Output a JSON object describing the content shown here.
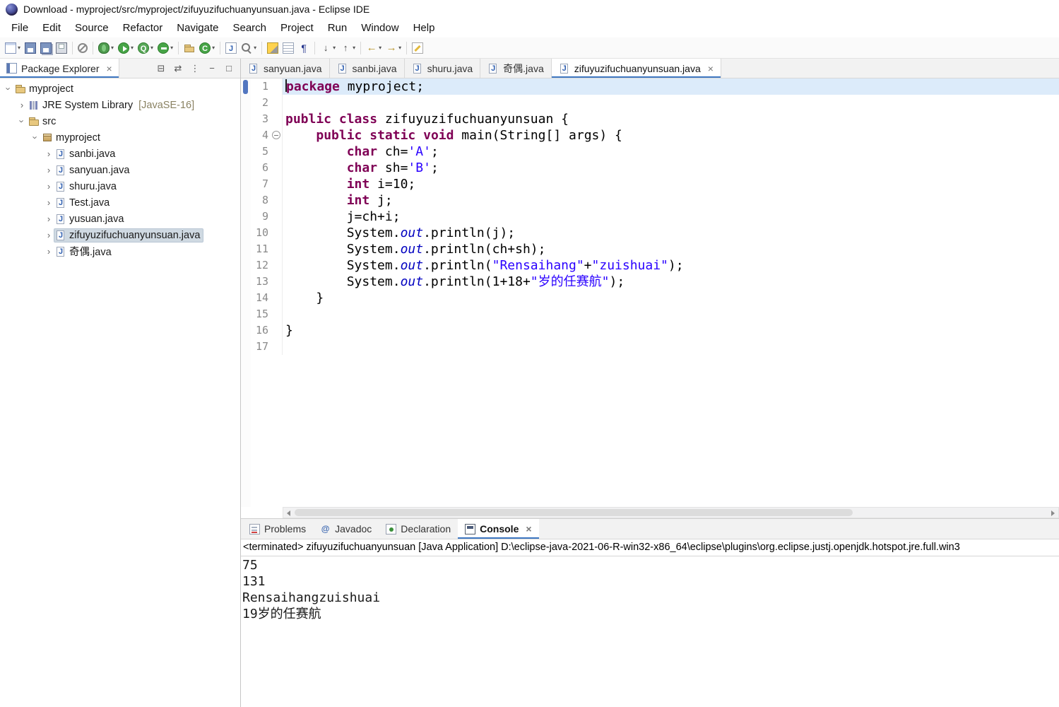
{
  "window": {
    "title": "Download - myproject/src/myproject/zifuyuzifuchuanyunsuan.java - Eclipse IDE"
  },
  "menubar": {
    "items": [
      "File",
      "Edit",
      "Source",
      "Refactor",
      "Navigate",
      "Search",
      "Project",
      "Run",
      "Window",
      "Help"
    ]
  },
  "glyphs": {
    "dropdown": "▾",
    "tree_collapsed": "›",
    "close": "×"
  },
  "toolbar": {
    "items": [
      {
        "name": "new-wizard",
        "icon": "new",
        "dd": true
      },
      {
        "name": "save",
        "icon": "save"
      },
      {
        "name": "save-all",
        "icon": "save-all"
      },
      {
        "name": "print",
        "icon": "print"
      },
      {
        "sep": true
      },
      {
        "name": "skip-all-breakpoints",
        "icon": "skip-bp"
      },
      {
        "sep": true
      },
      {
        "name": "debug",
        "icon": "debug",
        "dd": true
      },
      {
        "name": "run",
        "icon": "run",
        "dd": true
      },
      {
        "name": "coverage",
        "icon": "coverage",
        "dd": true
      },
      {
        "name": "run-external-tools",
        "icon": "external",
        "dd": true
      },
      {
        "sep": true
      },
      {
        "name": "new-java-project",
        "icon": "java-project"
      },
      {
        "name": "new-java-class",
        "icon": "java-class",
        "dd": true
      },
      {
        "sep": true
      },
      {
        "name": "open-type",
        "icon": "open-type"
      },
      {
        "name": "search",
        "icon": "search",
        "dd": true
      },
      {
        "sep": true
      },
      {
        "name": "toggle-mark-occurrences",
        "icon": "mark-occ"
      },
      {
        "name": "show-annotations",
        "icon": "annot"
      },
      {
        "name": "show-whitespace",
        "icon": "pilcrow",
        "glyph": "¶"
      },
      {
        "sep": true
      },
      {
        "name": "next-annotation",
        "icon": "next-annot",
        "glyph": "↓",
        "dd": true
      },
      {
        "name": "previous-annotation",
        "icon": "prev-annot",
        "glyph": "↑",
        "dd": true
      },
      {
        "sep": true
      },
      {
        "name": "back",
        "icon": "back",
        "glyph": "←",
        "dd": true
      },
      {
        "name": "forward",
        "icon": "forward",
        "glyph": "→",
        "dd": true
      },
      {
        "sep": true
      },
      {
        "name": "last-edit-location",
        "icon": "last-edit"
      }
    ]
  },
  "package_explorer": {
    "title": "Package Explorer",
    "actions": [
      {
        "name": "collapse-all",
        "glyph": "⊟"
      },
      {
        "name": "link-with-editor",
        "glyph": "⇄"
      },
      {
        "name": "view-menu",
        "glyph": "⋮"
      },
      {
        "name": "minimize",
        "glyph": "−"
      },
      {
        "name": "maximize",
        "glyph": "□"
      }
    ],
    "tree": [
      {
        "level": 0,
        "expanded": true,
        "icon": "project",
        "label": "myproject"
      },
      {
        "level": 1,
        "expanded": false,
        "icon": "library",
        "label": "JRE System Library",
        "decoration": "[JavaSE-16]"
      },
      {
        "level": 1,
        "expanded": true,
        "icon": "src",
        "label": "src"
      },
      {
        "level": 2,
        "expanded": true,
        "icon": "package",
        "label": "myproject"
      },
      {
        "level": 3,
        "expanded": false,
        "icon": "java",
        "label": "sanbi.java"
      },
      {
        "level": 3,
        "expanded": false,
        "icon": "java",
        "label": "sanyuan.java"
      },
      {
        "level": 3,
        "expanded": false,
        "icon": "java",
        "label": "shuru.java"
      },
      {
        "level": 3,
        "expanded": false,
        "icon": "java",
        "label": "Test.java"
      },
      {
        "level": 3,
        "expanded": false,
        "icon": "java",
        "label": "yusuan.java"
      },
      {
        "level": 3,
        "expanded": false,
        "icon": "java",
        "label": "zifuyuzifuchuanyunsuan.java",
        "selected": true
      },
      {
        "level": 3,
        "expanded": false,
        "icon": "java",
        "label": "奇偶.java"
      }
    ]
  },
  "editor": {
    "tabs": [
      {
        "label": "sanyuan.java"
      },
      {
        "label": "sanbi.java"
      },
      {
        "label": "shuru.java"
      },
      {
        "label": "奇偶.java"
      },
      {
        "label": "zifuyuzifuchuanyunsuan.java",
        "active": true
      }
    ],
    "current_line": 1,
    "lines": [
      {
        "num": 1,
        "seg": [
          {
            "t": "kw",
            "s": "package"
          },
          {
            "t": "p",
            "s": " myproject;"
          }
        ]
      },
      {
        "num": 2,
        "seg": []
      },
      {
        "num": 3,
        "seg": [
          {
            "t": "kw",
            "s": "public"
          },
          {
            "t": "p",
            "s": " "
          },
          {
            "t": "kw",
            "s": "class"
          },
          {
            "t": "p",
            "s": " zifuyuzifuchuanyunsuan {"
          }
        ]
      },
      {
        "num": 4,
        "fold": true,
        "seg": [
          {
            "t": "p",
            "s": "    "
          },
          {
            "t": "kw",
            "s": "public"
          },
          {
            "t": "p",
            "s": " "
          },
          {
            "t": "kw",
            "s": "static"
          },
          {
            "t": "p",
            "s": " "
          },
          {
            "t": "kw",
            "s": "void"
          },
          {
            "t": "p",
            "s": " main(String[] args) {"
          }
        ]
      },
      {
        "num": 5,
        "seg": [
          {
            "t": "p",
            "s": "        "
          },
          {
            "t": "kw",
            "s": "char"
          },
          {
            "t": "p",
            "s": " ch="
          },
          {
            "t": "str",
            "s": "'A'"
          },
          {
            "t": "p",
            "s": ";"
          }
        ]
      },
      {
        "num": 6,
        "seg": [
          {
            "t": "p",
            "s": "        "
          },
          {
            "t": "kw",
            "s": "char"
          },
          {
            "t": "p",
            "s": " sh="
          },
          {
            "t": "str",
            "s": "'B'"
          },
          {
            "t": "p",
            "s": ";"
          }
        ]
      },
      {
        "num": 7,
        "seg": [
          {
            "t": "p",
            "s": "        "
          },
          {
            "t": "kw",
            "s": "int"
          },
          {
            "t": "p",
            "s": " i=10;"
          }
        ]
      },
      {
        "num": 8,
        "seg": [
          {
            "t": "p",
            "s": "        "
          },
          {
            "t": "kw",
            "s": "int"
          },
          {
            "t": "p",
            "s": " j;"
          }
        ]
      },
      {
        "num": 9,
        "seg": [
          {
            "t": "p",
            "s": "        j=ch+i;"
          }
        ]
      },
      {
        "num": 10,
        "seg": [
          {
            "t": "p",
            "s": "        System."
          },
          {
            "t": "f",
            "s": "out"
          },
          {
            "t": "p",
            "s": ".println(j);"
          }
        ]
      },
      {
        "num": 11,
        "seg": [
          {
            "t": "p",
            "s": "        System."
          },
          {
            "t": "f",
            "s": "out"
          },
          {
            "t": "p",
            "s": ".println(ch+sh);"
          }
        ]
      },
      {
        "num": 12,
        "seg": [
          {
            "t": "p",
            "s": "        System."
          },
          {
            "t": "f",
            "s": "out"
          },
          {
            "t": "p",
            "s": ".println("
          },
          {
            "t": "str",
            "s": "\"Rensaihang\""
          },
          {
            "t": "p",
            "s": "+"
          },
          {
            "t": "str",
            "s": "\"zuishuai\""
          },
          {
            "t": "p",
            "s": ");"
          }
        ]
      },
      {
        "num": 13,
        "seg": [
          {
            "t": "p",
            "s": "        System."
          },
          {
            "t": "f",
            "s": "out"
          },
          {
            "t": "p",
            "s": ".println(1+18+"
          },
          {
            "t": "str",
            "s": "\"岁的任赛航\""
          },
          {
            "t": "p",
            "s": ");"
          }
        ]
      },
      {
        "num": 14,
        "seg": [
          {
            "t": "p",
            "s": "    }"
          }
        ]
      },
      {
        "num": 15,
        "seg": []
      },
      {
        "num": 16,
        "seg": [
          {
            "t": "p",
            "s": "}"
          }
        ]
      },
      {
        "num": 17,
        "seg": []
      }
    ]
  },
  "console": {
    "tabs": [
      {
        "label": "Problems",
        "icon": "problems"
      },
      {
        "label": "Javadoc",
        "icon": "javadoc"
      },
      {
        "label": "Declaration",
        "icon": "declaration"
      },
      {
        "label": "Console",
        "icon": "console",
        "active": true
      }
    ],
    "header": "<terminated> zifuyuzifuchuanyunsuan [Java Application] D:\\eclipse-java-2021-06-R-win32-x86_64\\eclipse\\plugins\\org.eclipse.justj.openjdk.hotspot.jre.full.win3",
    "output": [
      "75",
      "131",
      "Rensaihangzuishuai",
      "19岁的任赛航"
    ]
  }
}
